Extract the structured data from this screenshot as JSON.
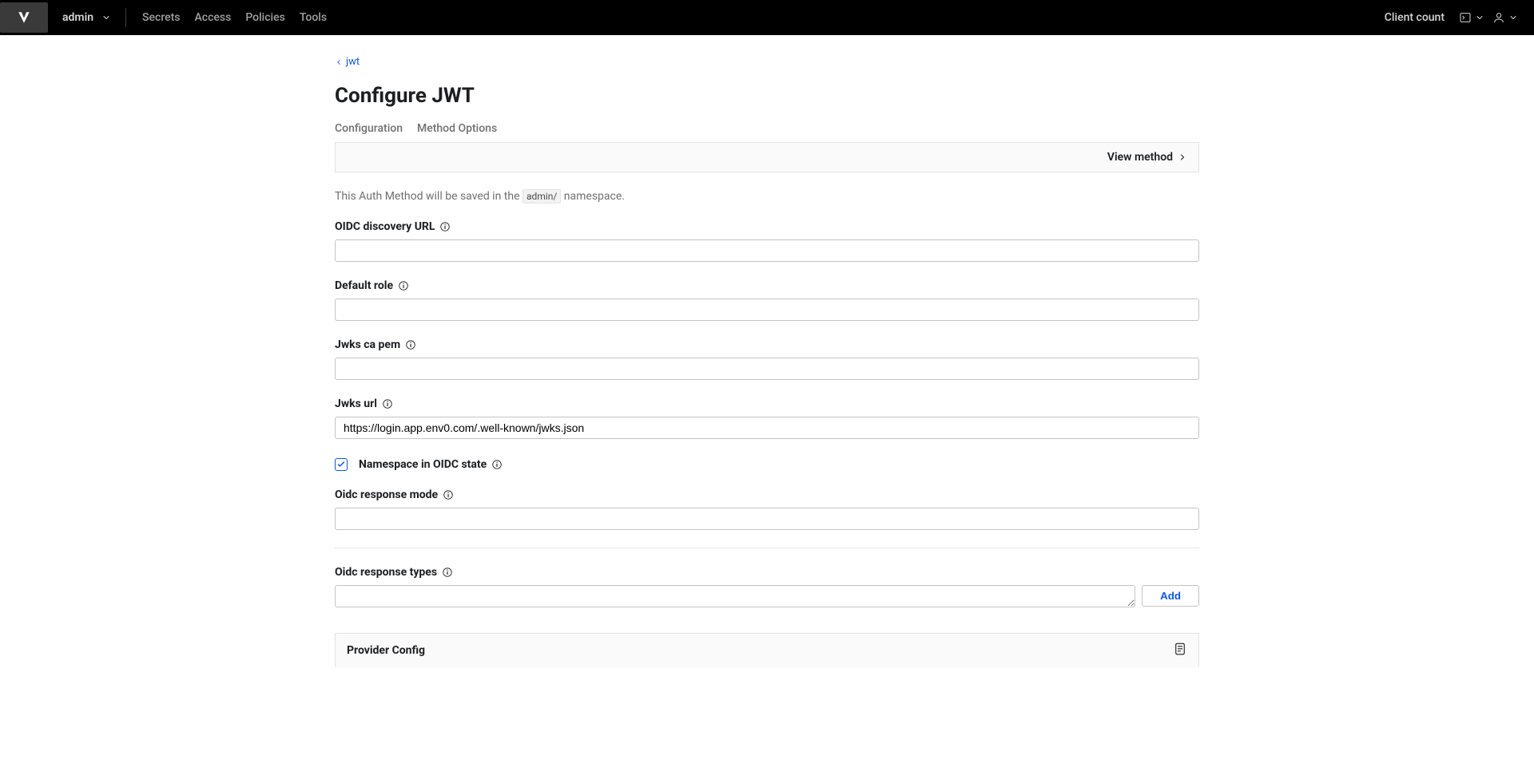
{
  "header": {
    "namespace_label": "admin",
    "nav": {
      "secrets": "Secrets",
      "access": "Access",
      "policies": "Policies",
      "tools": "Tools"
    },
    "client_count": "Client count"
  },
  "breadcrumb": {
    "label": "jwt"
  },
  "page": {
    "title": "Configure JWT"
  },
  "tabs": {
    "configuration": "Configuration",
    "method_options": "Method Options"
  },
  "actions": {
    "view_method": "View method",
    "add": "Add"
  },
  "ns_note": {
    "prefix": "This Auth Method will be saved in the ",
    "chip": "admin/",
    "suffix": " namespace."
  },
  "fields": {
    "oidc_discovery_url": {
      "label": "OIDC discovery URL",
      "value": ""
    },
    "default_role": {
      "label": "Default role",
      "value": ""
    },
    "jwks_ca_pem": {
      "label": "Jwks ca pem",
      "value": ""
    },
    "jwks_url": {
      "label": "Jwks url",
      "value": "https://login.app.env0.com/.well-known/jwks.json"
    },
    "namespace_in_state": {
      "label": "Namespace in OIDC state",
      "checked": true
    },
    "oidc_response_mode": {
      "label": "Oidc response mode",
      "value": ""
    },
    "oidc_response_types": {
      "label": "Oidc response types",
      "value": ""
    },
    "provider_config": {
      "label": "Provider Config"
    }
  }
}
